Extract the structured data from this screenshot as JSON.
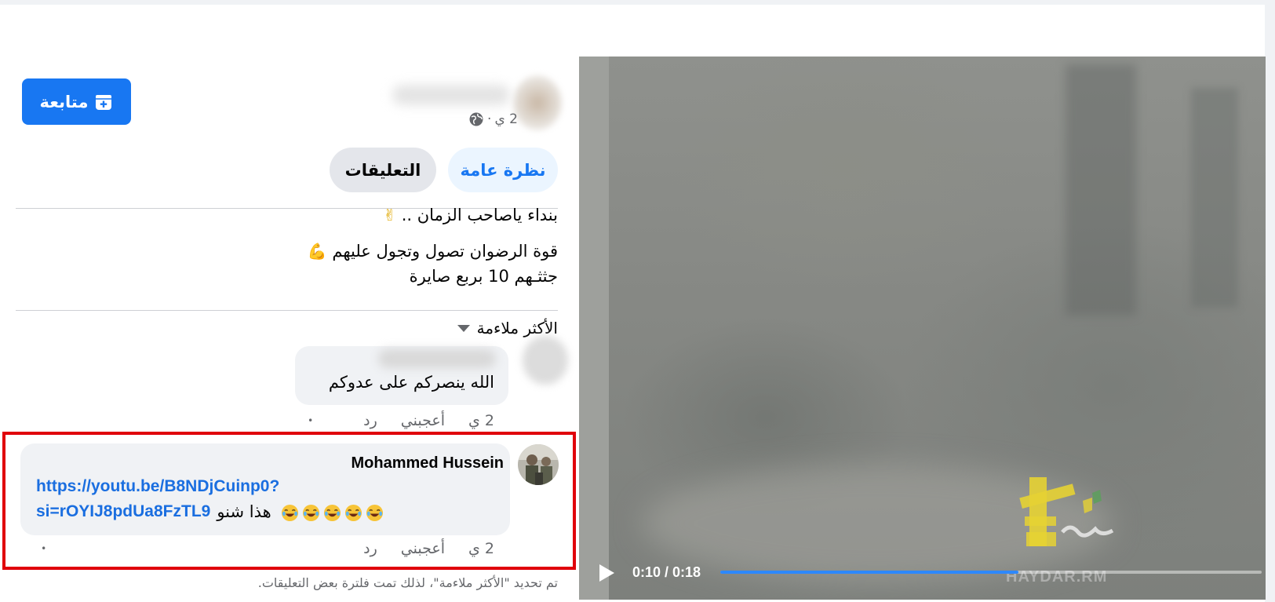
{
  "post": {
    "meta_time": "2 ي",
    "meta_separator": "·",
    "follow_label": "متابعة",
    "text_line1": "بنداء ياصاحب الزمان ..",
    "text_line1_emoji": "✌",
    "text_line2": "قوة الرضوان تصول وتجول عليهم",
    "text_line2_emoji": "💪",
    "text_line3": "جثثـهم 10 بربع صايرة"
  },
  "tabs": [
    {
      "label": "نظرة عامة",
      "active": true
    },
    {
      "label": "التعليقات",
      "active": false
    }
  ],
  "sort": {
    "label": "الأكثر ملاءمة"
  },
  "comments": [
    {
      "text": "الله ينصركم على عدوكم",
      "time": "2 ي",
      "like_label": "أعجبني",
      "reply_label": "رد",
      "dot": "•"
    },
    {
      "author": "Mohammed Hussein",
      "link_line1": "https://youtu.be/B8NDjCuinp0?",
      "link_line2": "si=rOYIJ8pdUa8FzTL9",
      "text": "هذا شنو",
      "laugh_count": 5,
      "time": "2 ي",
      "like_label": "أعجبني",
      "reply_label": "رد",
      "dot": "•"
    }
  ],
  "footer_note": "تم تحديد \"الأكثر ملاءمة\"، لذلك تمت فلترة بعض التعليقات.",
  "video": {
    "time": "0:10 / 0:18",
    "progress": 0.55,
    "watermark": "HAYDAR.RM"
  },
  "colors": {
    "accent": "#1877f2",
    "highlight_border": "#e0000b",
    "link": "#1a6ee0",
    "progress": "#2d88ff"
  }
}
